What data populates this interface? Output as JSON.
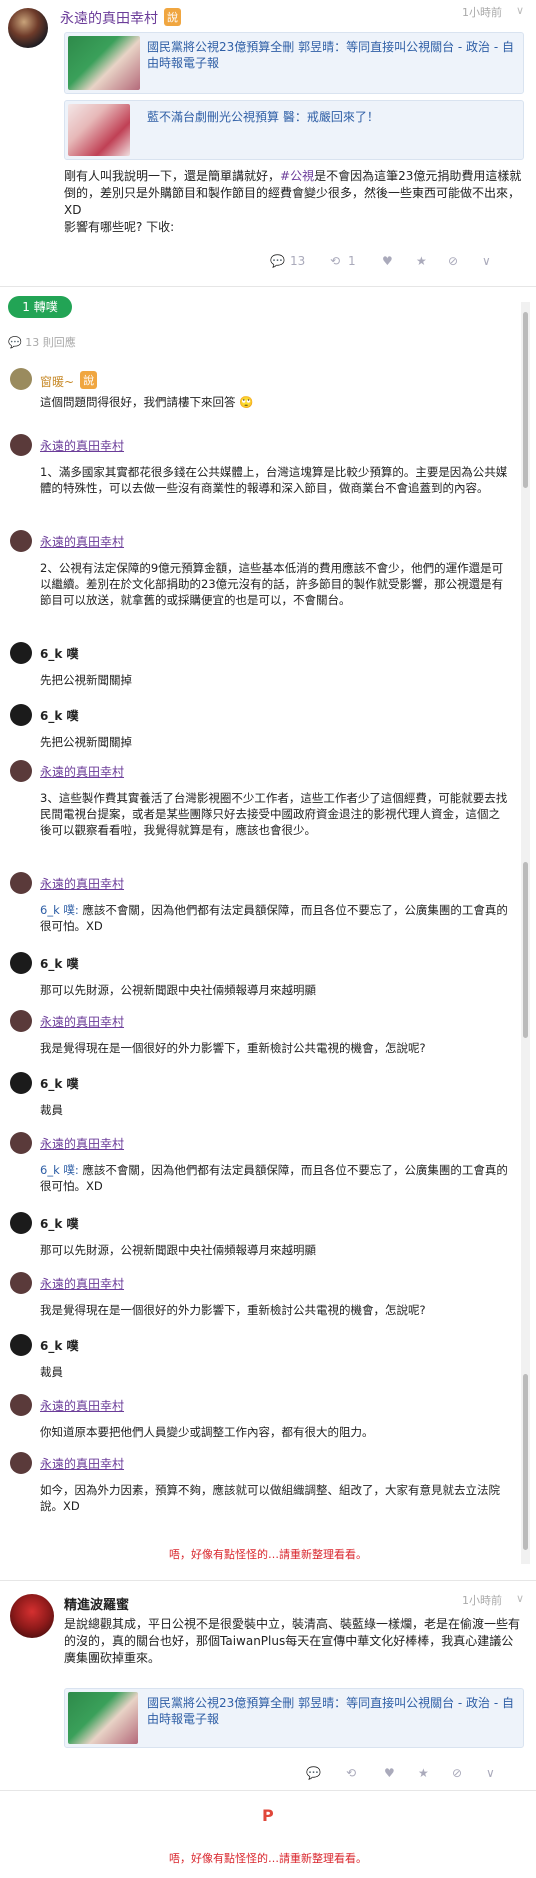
{
  "post1": {
    "author": "永遠的真田幸村",
    "badge": "說",
    "time": "1小時前",
    "chev": "∨",
    "link1_title": "國民黨將公視23億預算全刪 郭昱晴：等同直接叫公視關台 - 政治 - 自由時報電子報",
    "link2_title": "藍不滿台劇刪光公視預算 醫：戒嚴回來了！",
    "text_a": "剛有人叫我說明一下，還是簡單講就好，",
    "tag": "#公視",
    "text_b": "是不會因為這筆23億元捐助費用這樣就倒的，差別只是外購節目和製作節目的經費會變少很多，然後一些東西可能做不出來，XD",
    "text_c": "影響有哪些呢? 下收:",
    "comments_count": "13",
    "reposts_count": "1"
  },
  "thread": {
    "repost_pill": "1 轉噗",
    "reply_count_label": "13 則回應"
  },
  "replies": [
    {
      "name": "窗暖~",
      "badge": "說",
      "text": "這個問題問得很好，我們請樓下來回答 🙄"
    },
    {
      "name": "永遠的真田幸村",
      "text": "1、滿多國家其實都花很多錢在公共媒體上，台灣這塊算是比較少預算的。主要是因為公共媒體的特殊性，可以去做一些沒有商業性的報導和深入節目，做商業台不會追蓋到的內容。"
    },
    {
      "name": "永遠的真田幸村",
      "text": "2、公視有法定保障的9億元預算金額，這些基本低消的費用應該不會少，他們的運作還是可以繼續。差別在於文化部捐助的23億元沒有的話，許多節目的製作就受影響，那公視還是有節目可以放送，就拿舊的或採購便宜的也是可以，不會關台。"
    },
    {
      "name": "6_k 噗",
      "text": "先把公視新聞關掉"
    },
    {
      "name": "6_k 噗",
      "text": "先把公視新聞關掉"
    },
    {
      "name": "永遠的真田幸村",
      "text": "3、這些製作費其實養活了台灣影視圈不少工作者，這些工作者少了這個經費，可能就要去找民間電視台提案，或者是某些團隊只好去接受中國政府資金退注的影視代理人資金，這個之後可以觀察看看啦，我覺得就算是有，應該也會很少。"
    },
    {
      "name": "永遠的真田幸村",
      "mention": "6_k 噗:",
      "text": " 應該不會關，因為他們都有法定員額保障，而且各位不要忘了，公廣集團的工會真的很可怕。XD"
    },
    {
      "name": "6_k 噗",
      "text": "那可以先財源，公視新聞跟中央社倆頻報導月來越明顯"
    },
    {
      "name": "永遠的真田幸村",
      "text": "我是覺得現在是一個很好的外力影響下，重新檢討公共電視的機會，怎說呢?"
    },
    {
      "name": "6_k 噗",
      "text": "裁員"
    },
    {
      "name": "永遠的真田幸村",
      "mention": "6_k 噗:",
      "text": " 應該不會關，因為他們都有法定員額保障，而且各位不要忘了，公廣集團的工會真的很可怕。XD"
    },
    {
      "name": "6_k 噗",
      "text": "那可以先財源，公視新聞跟中央社倆頻報導月來越明顯"
    },
    {
      "name": "永遠的真田幸村",
      "text": "我是覺得現在是一個很好的外力影響下，重新檢討公共電視的機會，怎說呢?"
    },
    {
      "name": "6_k 噗",
      "text": "裁員"
    },
    {
      "name": "永遠的真田幸村",
      "text": "你知道原本要把他們人員變少或調整工作內容，都有很大的阻力。"
    },
    {
      "name": "永遠的真田幸村",
      "text": "如今，因為外力因素，預算不夠，應該就可以做組織調整、組改了，大家有意見就去立法院說。XD"
    }
  ],
  "error_msg": "唔，好像有點怪怪的…請重新整理看看。",
  "post2": {
    "author": "精進波羅蜜",
    "time": "1小時前",
    "chev": "∨",
    "text": "是說總觀其成，平日公視不是很愛裝中立，裝清高、裝藍綠一樣爛，老是在偷渡一些有的沒的，真的關台也好，那個TaiwanPlus每天在宣傳中華文化好棒棒，我真心建議公廣集團砍掉重來。",
    "link_title": "國民黨將公視23億預算全刪 郭昱晴：等同直接叫公視關台 - 政治 - 自由時報電子報"
  },
  "footer_mark": "P",
  "footer_error": "唔，好像有點怪怪的…請重新整理看看。",
  "colors": {
    "author": "#6b3c99",
    "link": "#2f5fa6",
    "pill": "#22a455",
    "error": "#d9262d"
  }
}
